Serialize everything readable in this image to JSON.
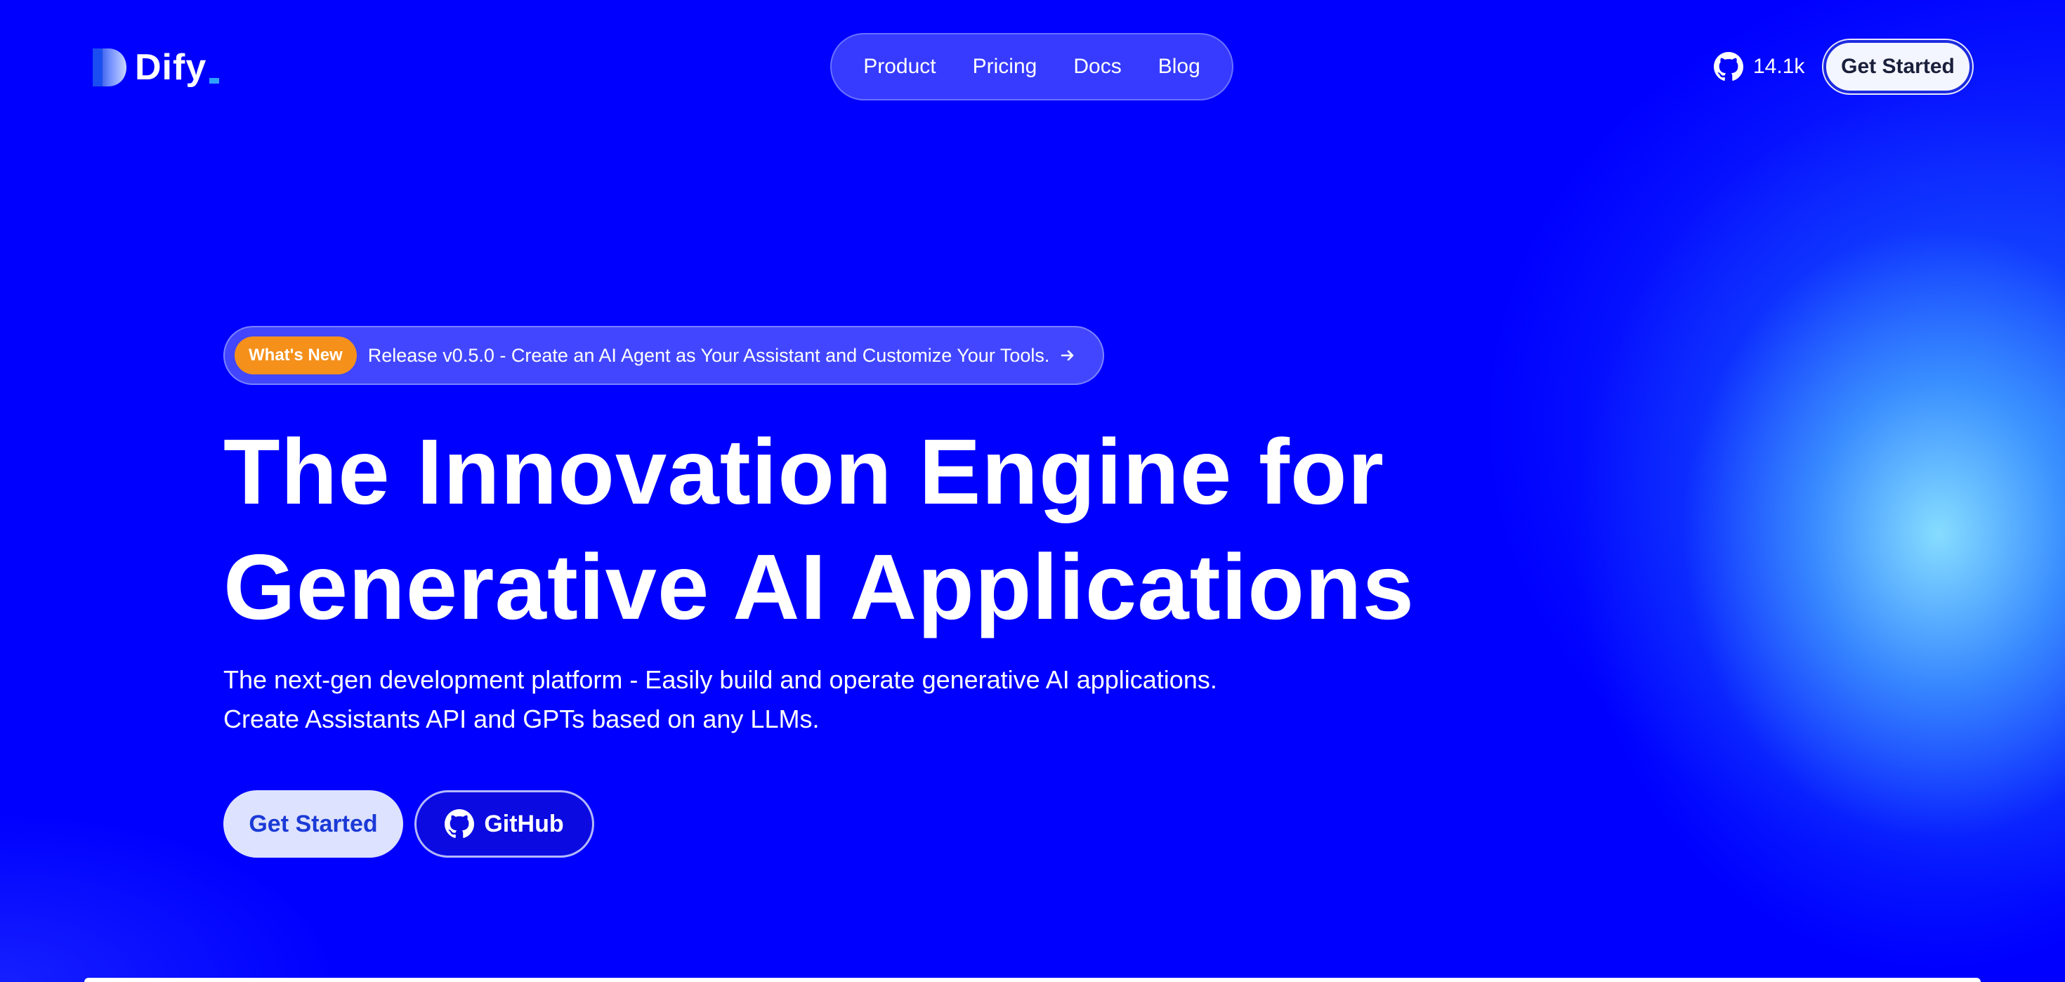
{
  "header": {
    "logo_text": "Dify",
    "nav": [
      {
        "label": "Product"
      },
      {
        "label": "Pricing"
      },
      {
        "label": "Docs"
      },
      {
        "label": "Blog"
      }
    ],
    "github_stars": "14.1k",
    "cta_label": "Get Started"
  },
  "announcement": {
    "badge": "What's New",
    "text": "Release v0.5.0 - Create an AI Agent as Your Assistant and Customize Your Tools.",
    "icon": "arrow-right-icon"
  },
  "hero": {
    "title_line1": "The Innovation Engine for",
    "title_line2": "Generative AI Applications",
    "subtitle_line1": "The next-gen development platform - Easily build and operate generative AI applications.",
    "subtitle_line2": "Create Assistants API and GPTs based on any LLMs.",
    "primary_cta": "Get Started",
    "secondary_cta": "GitHub",
    "secondary_icon": "github-icon"
  },
  "colors": {
    "background": "#0000ff",
    "badge": "#f5901b",
    "primary_button_bg": "#dde2ff",
    "primary_button_text": "#1b3ad6",
    "logo_accent": "#2ea0ff"
  }
}
